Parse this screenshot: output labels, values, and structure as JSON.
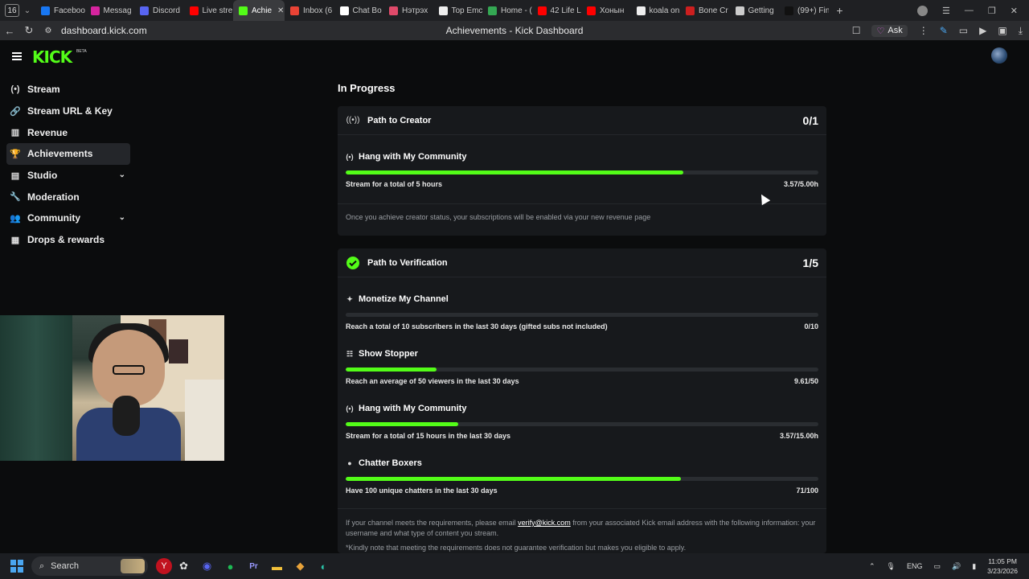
{
  "browser": {
    "tab_count": "16",
    "tabs": [
      {
        "label": "Faceboo",
        "color": "#1877f2",
        "active": false
      },
      {
        "label": "Messag",
        "color": "#d6249f",
        "active": false
      },
      {
        "label": "Discord",
        "color": "#5865f2",
        "active": false
      },
      {
        "label": "Live stre",
        "color": "#ff0000",
        "active": false
      },
      {
        "label": "Achie",
        "color": "#53fc18",
        "active": true
      },
      {
        "label": "Inbox (6",
        "color": "#ea4335",
        "active": false
      },
      {
        "label": "Chat Bo",
        "color": "#ffffff",
        "active": false
      },
      {
        "label": "Нэтрэх",
        "color": "#e04a6a",
        "active": false
      },
      {
        "label": "Top Emc",
        "color": "#eeeeee",
        "active": false
      },
      {
        "label": "Home - (",
        "color": "#34a853",
        "active": false
      },
      {
        "label": "42 Life L",
        "color": "#ff0000",
        "active": false
      },
      {
        "label": "Хонын",
        "color": "#ff0000",
        "active": false
      },
      {
        "label": "koala on",
        "color": "#eeeeee",
        "active": false
      },
      {
        "label": "Bone Cr",
        "color": "#cc1f1f",
        "active": false
      },
      {
        "label": "Getting",
        "color": "#cccccc",
        "active": false
      },
      {
        "label": "(99+) Fin",
        "color": "#111111",
        "active": false
      }
    ],
    "url": "dashboard.kick.com",
    "page_title": "Achievements - Kick Dashboard",
    "ask_label": "Ask"
  },
  "kick": {
    "logo": "KICK",
    "beta": "BETA"
  },
  "sidebar": {
    "items": [
      {
        "label": "Stream",
        "icon": "(•)",
        "icon_name": "broadcast-icon",
        "active": false,
        "chevron": false
      },
      {
        "label": "Stream URL & Key",
        "icon": "🔗",
        "icon_name": "link-icon",
        "active": false,
        "chevron": false
      },
      {
        "label": "Revenue",
        "icon": "▥",
        "icon_name": "revenue-chart-icon",
        "active": false,
        "chevron": false
      },
      {
        "label": "Achievements",
        "icon": "🏆",
        "icon_name": "trophy-icon",
        "active": true,
        "chevron": false
      },
      {
        "label": "Studio",
        "icon": "▤",
        "icon_name": "studio-icon",
        "active": false,
        "chevron": true
      },
      {
        "label": "Moderation",
        "icon": "🔧",
        "icon_name": "wrench-icon",
        "active": false,
        "chevron": false
      },
      {
        "label": "Community",
        "icon": "👥",
        "icon_name": "community-icon",
        "active": false,
        "chevron": true
      },
      {
        "label": "Drops & rewards",
        "icon": "▦",
        "icon_name": "gift-icon",
        "active": false,
        "chevron": false
      }
    ]
  },
  "main": {
    "section_title": "In Progress",
    "creator": {
      "title": "Path to Creator",
      "count": "0/1",
      "task_title": "Hang with My Community",
      "task_desc": "Stream for a total of 5 hours",
      "task_value": "3.57/5.00h",
      "progress": 0.714,
      "note": "Once you achieve creator status, your subscriptions will be enabled via your new revenue page"
    },
    "verification": {
      "title": "Path to Verification",
      "count": "1/5",
      "tasks": [
        {
          "title": "Monetize My Channel",
          "icon": "✦",
          "icon_name": "sparkle-icon",
          "desc": "Reach a total of 10 subscribers in the last 30 days (gifted subs not included)",
          "value": "0/10",
          "progress": 0.0
        },
        {
          "title": "Show Stopper",
          "icon": "☷",
          "icon_name": "viewers-icon",
          "desc": "Reach an average of 50 viewers in the last 30 days",
          "value": "9.61/50",
          "progress": 0.1922
        },
        {
          "title": "Hang with My Community",
          "icon": "(•)",
          "icon_name": "broadcast-icon",
          "desc": "Stream for a total of 15 hours in the last 30 days",
          "value": "3.57/15.00h",
          "progress": 0.238
        },
        {
          "title": "Chatter Boxers",
          "icon": "●",
          "icon_name": "chat-bubble-icon",
          "desc": "Have 100 unique chatters in the last 30 days",
          "value": "71/100",
          "progress": 0.71
        }
      ],
      "note_prefix": "If your channel meets the requirements, please email ",
      "note_email": "verify@kick.com",
      "note_suffix": " from your associated Kick email address with the following information: your username and what type of content you stream.",
      "note2": "*Kindly note that meeting the requirements does not guarantee verification but makes you eligible to apply."
    }
  },
  "taskbar": {
    "search_label": "Search",
    "lang": "ENG",
    "time": "11:05 PM",
    "date": "3/23/2026"
  }
}
